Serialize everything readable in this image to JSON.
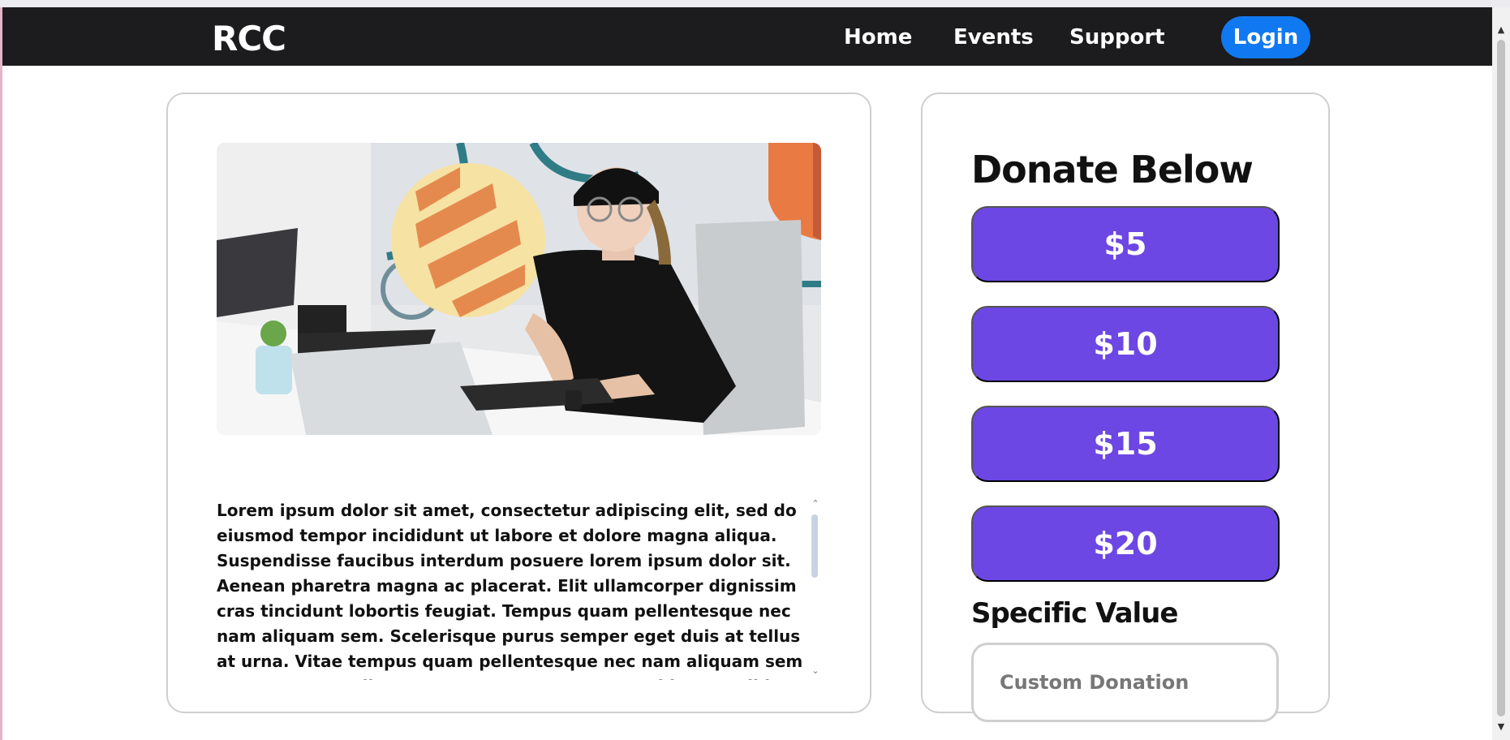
{
  "navbar": {
    "brand": "RCC",
    "links": [
      {
        "label": "Home"
      },
      {
        "label": "Events"
      },
      {
        "label": "Support"
      }
    ],
    "login_label": "Login"
  },
  "article": {
    "image_alt": "Person wearing a black beanie and round glasses working at a laptop with a drawing tablet",
    "text": "Lorem ipsum dolor sit amet, consectetur adipiscing elit, sed do eiusmod tempor incididunt ut labore et dolore magna aliqua. Suspendisse faucibus interdum posuere lorem ipsum dolor sit. Aenean pharetra magna ac placerat. Elit ullamcorper dignissim cras tincidunt lobortis feugiat. Tempus quam pellentesque nec nam aliquam sem. Scelerisque purus semper eget duis at tellus at urna. Vitae tempus quam pellentesque nec nam aliquam sem et tortor. Nam aliquam sem et tortor consequat id porta nibh. Dolor sagittis eget."
  },
  "donate": {
    "title": "Donate Below",
    "amounts": [
      "$5",
      "$10",
      "$15",
      "$20"
    ],
    "specific_label": "Specific Value",
    "custom_placeholder": "Custom Donation"
  },
  "colors": {
    "navbar_bg": "#1c1b1d",
    "login_bg": "#1079f1",
    "amount_button_bg": "#6c47e3"
  }
}
